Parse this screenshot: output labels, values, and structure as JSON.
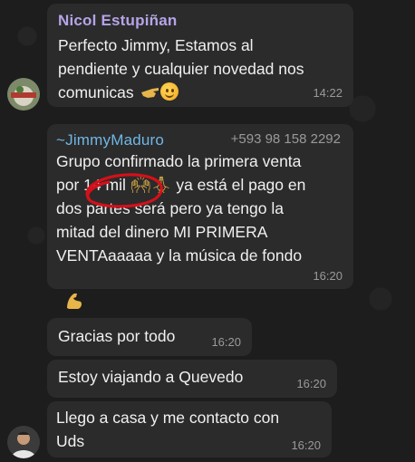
{
  "messages": {
    "nicol": {
      "sender": "Nicol Estupiñan",
      "line1": "Perfecto Jimmy, Estamos al",
      "line2": "pendiente y cualquier novedad nos",
      "line3": "comunicas",
      "time": "14:22"
    },
    "jimmy": {
      "sender": "~JimmyMaduro",
      "phone": "+593 98 158 2292",
      "line1": "Grupo confirmado la primera venta",
      "line2a": "por",
      "line2b": "14 mil",
      "line2c": "ya está el pago en",
      "line3": "dos partes será pero ya tengo la",
      "line4": "mitad del dinero MI PRIMERA",
      "line5": "VENTAaaaaa y la música de fondo",
      "time": "16:20"
    },
    "gracias": {
      "text": "Gracias por todo",
      "time": "16:20"
    },
    "viajando": {
      "text": "Estoy viajando a Quevedo",
      "time": "16:20"
    },
    "llego": {
      "line1": "Llego a casa y me contacto con",
      "line2": "Uds",
      "time": "16:20"
    }
  },
  "colors": {
    "nicol_name": "#b6a4e8",
    "jimmy_name": "#6fb7e6",
    "bubble": "#2b2b2b",
    "annotation": "#d4101a"
  },
  "icons": [
    "pointing-hand-icon",
    "smiling-face-icon",
    "raised-hands-icon",
    "folded-hands-icon",
    "flexed-biceps-icon"
  ]
}
